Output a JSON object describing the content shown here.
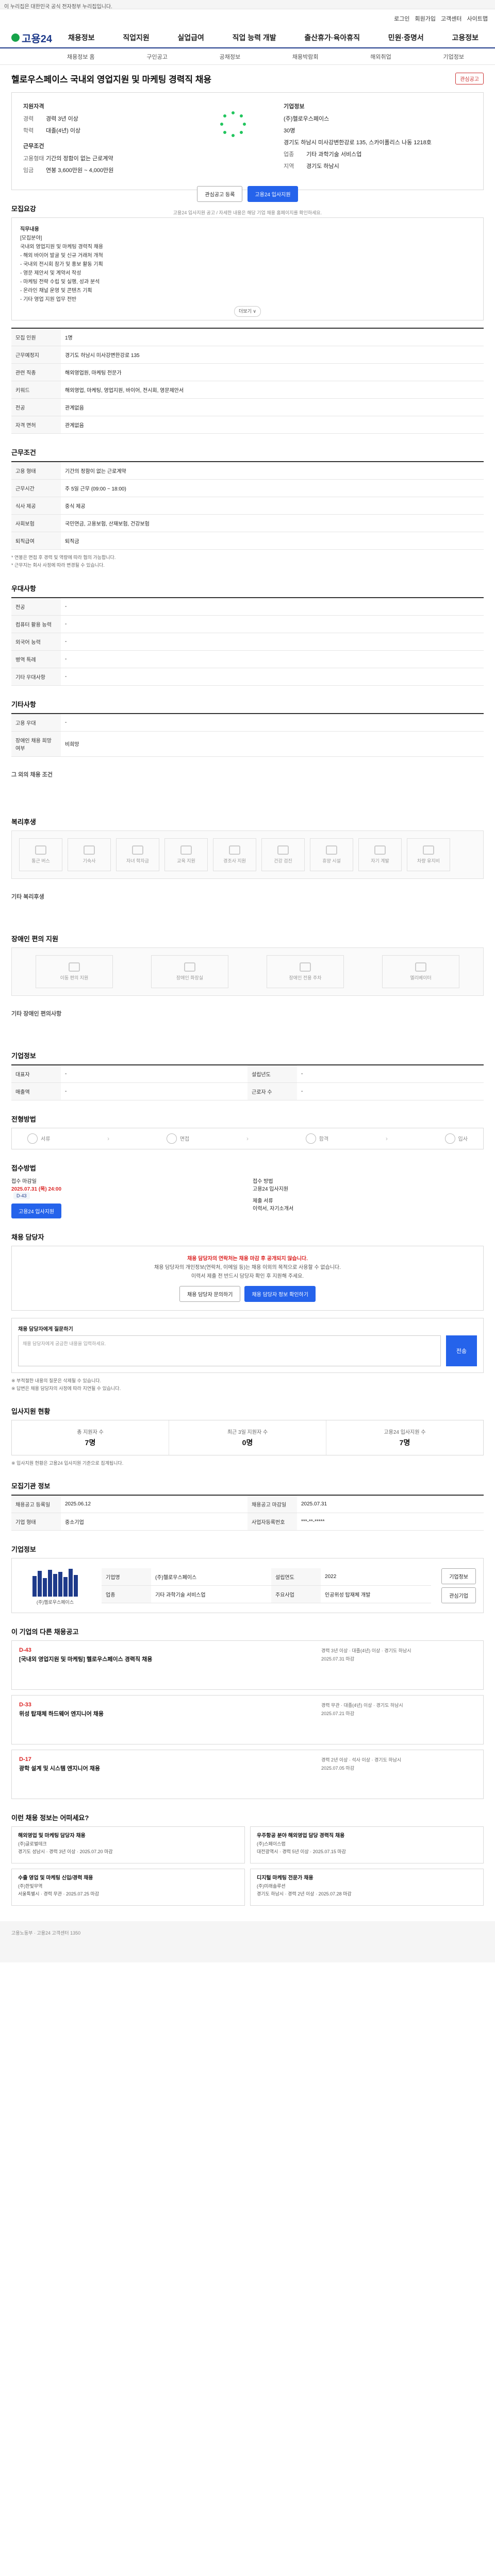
{
  "gov_bar": "이 누리집은 대한민국 공식 전자정부 누리집입니다.",
  "util": [
    "로그인",
    "회원가입",
    "고객센터",
    "사이트맵"
  ],
  "logo": "고용24",
  "gnb": [
    "채용정보",
    "직업지원",
    "실업급여",
    "직업 능력 개발",
    "출산휴가·육아휴직",
    "민원·증명서",
    "고용정보",
    "로그인"
  ],
  "lnb": [
    "채용정보 홈",
    "구인공고",
    "공채정보",
    "채용박람회",
    "해외취업",
    "기업정보"
  ],
  "job": {
    "title": "헬로우스페이스 국내외 영업지원 및 마케팅 경력직 채용",
    "scrap_label": "관심공고",
    "company_head": "기업정보",
    "company_name": "(주)헬로우스페이스",
    "employees": "30명",
    "address": "경기도 하남시 미사강변한강로 135, 스카이폴리스 나동 1218호",
    "type_label": "업종",
    "type_value": "기타 과학기술 서비스업",
    "cond_head": "지원자격",
    "career_k": "경력",
    "career_v": "경력 3년 이상",
    "edu_k": "학력",
    "edu_v": "대졸(4년) 이상",
    "work_head": "근무조건",
    "emp_k": "고용형태",
    "emp_v": "기간의 정함이 없는 근로계약",
    "wage_k": "임금",
    "wage_v": "연봉 3,600만원 ~ 4,000만원",
    "region_k": "지역",
    "region_v": "경기도 하남시",
    "scrap_btn": "관심공고 등록",
    "apply_btn": "고용24 입사지원",
    "note": "고용24 입사지원 공고 / 자세한 내용은 해당 기업 채용 홈페이지를 확인하세요."
  },
  "sections": {
    "recruit": "모집요강",
    "content_title": "직무내용",
    "content_sub": "[모집분야]",
    "content_lines": [
      "국내외 영업지원 및 마케팅 경력직 채용",
      "- 해외 바이어 발굴 및 신규 거래처 개척",
      "- 국내외 전시회 참가 및 홍보 활동 기획",
      "- 영문 제안서 및 계약서 작성",
      "- 마케팅 전략 수립 및 실행, 성과 분석",
      "- 온라인 채널 운영 및 콘텐츠 기획",
      "- 기타 영업 지원 업무 전반"
    ],
    "more": "더보기 ∨",
    "rows": [
      {
        "k": "모집 인원",
        "v": "1명"
      },
      {
        "k": "근무예정지",
        "v": "경기도 하남시 미사강변한강로 135"
      },
      {
        "k": "관련 직종",
        "v": "해외영업원, 마케팅 전문가"
      },
      {
        "k": "키워드",
        "v": "해외영업, 마케팅, 영업지원, 바이어, 전시회, 영문제안서"
      },
      {
        "k": "전공",
        "v": "관계없음"
      },
      {
        "k": "자격 면허",
        "v": "관계없음"
      }
    ],
    "work": "근무조건",
    "work_rows": [
      {
        "k": "고용 형태",
        "v": "기간의 정함이 없는 근로계약"
      },
      {
        "k": "근무시간",
        "v": "주 5일 근무 (09:00 ~ 18:00)"
      },
      {
        "k": "식사 제공",
        "v": "중식 제공"
      },
      {
        "k": "사회보험",
        "v": "국민연금, 고용보험, 산재보험, 건강보험"
      },
      {
        "k": "퇴직급여",
        "v": "퇴직금"
      }
    ],
    "work_notes": [
      "* 연봉은 면접 후 경력 및 역량에 따라 협의 가능합니다.",
      "* 근무지는 회사 사정에 따라 변경될 수 있습니다."
    ],
    "pref": "우대사항",
    "pref_rows": [
      {
        "k": "전공",
        "v": "-"
      },
      {
        "k": "컴퓨터 활용 능력",
        "v": "-"
      },
      {
        "k": "외국어 능력",
        "v": "-"
      },
      {
        "k": "병역 특례",
        "v": "-"
      },
      {
        "k": "기타 우대사항",
        "v": "-"
      }
    ],
    "etc": "기타사항",
    "etc_rows": [
      {
        "k": "고용 우대",
        "v": "-"
      },
      {
        "k": "장애인 채용 희망 여부",
        "v": "비희망"
      }
    ],
    "etc_extra": "그 외의 채용 조건",
    "welfare": "복리후생",
    "welfare_items": [
      "통근 버스",
      "기숙사",
      "자녀 학자금",
      "교육 지원",
      "경조사 지원",
      "건강 검진",
      "휴양 시설",
      "자기 계발",
      "차량 유지비"
    ],
    "welfare_extra": "기타 복리후생",
    "disab": "장애인 편의 지원",
    "disab_items": [
      "이동 편의 지원",
      "장애인 화장실",
      "장애인 전용 주차",
      "엘리베이터"
    ],
    "disab_extra": "기타 장애인 편의사항",
    "company_info": "기업정보",
    "ci_rows": [
      {
        "k": "대표자",
        "v": "-"
      },
      {
        "k": "설립년도",
        "v": "-"
      },
      {
        "k": "매출액",
        "v": "-"
      },
      {
        "k": "근로자 수",
        "v": "-"
      }
    ],
    "process": "전형방법",
    "process_steps": [
      "서류",
      "면접",
      "합격",
      "입사"
    ],
    "apply": "접수방법",
    "deadline_k": "접수 마감일",
    "deadline_v": "2025.07.31 (목) 24:00",
    "dday": "D-43",
    "method_k": "접수 방법",
    "method_v": "고용24 입사지원",
    "docs_k": "제출 서류",
    "docs_v": "이력서, 자기소개서",
    "contact": "채용 담당자",
    "contact_notice": "채용 담당자의 연락처는 채용 마감 후 공개되지 않습니다.",
    "contact_lines": [
      "채용 담당자의 개인정보(연락처, 이메일 등)는 채용 이외의 목적으로 사용할 수 없습니다.",
      "이력서 제출 전 반드시 담당자 확인 후 지원해 주세요."
    ],
    "contact_btn1": "채용 담당자 문의하기",
    "contact_btn2": "채용 담당자 정보 확인하기",
    "inq_title": "채용 담당자에게 질문하기",
    "inq_placeholder": "채용 담당자에게 궁금한 내용을 입력하세요.",
    "inq_btn": "전송",
    "inq_notes": [
      "※ 부적절한 내용의 질문은 삭제될 수 있습니다.",
      "※ 답변은 채용 담당자의 사정에 따라 지연될 수 있습니다."
    ],
    "stats": "입사지원 현황",
    "stats_items": [
      {
        "k": "총 지원자 수",
        "v": "7명"
      },
      {
        "k": "최근 3일 지원자 수",
        "v": "0명"
      },
      {
        "k": "고용24 입사지원 수",
        "v": "7명"
      }
    ],
    "stats_note": "※ 입사지원 현황은 고용24 입사지원 기준으로 집계됩니다.",
    "info": "모집기관 정보",
    "info_rows": [
      {
        "k": "채용공고 등록일",
        "v": "2025.06.12"
      },
      {
        "k": "채용공고 마감일",
        "v": "2025.07.31"
      },
      {
        "k": "기업 형태",
        "v": "중소기업"
      },
      {
        "k": "사업자등록번호",
        "v": "***-**-*****"
      }
    ],
    "corp": "기업정보",
    "corp_name": "(주)헬로우스페이스",
    "corp_rows": [
      {
        "k": "기업명",
        "v": "(주)헬로우스페이스"
      },
      {
        "k": "업종",
        "v": "기타 과학기술 서비스업"
      },
      {
        "k": "주요사업",
        "v": "인공위성 탑재체 개발"
      },
      {
        "k": "설립연도",
        "v": "2022"
      }
    ],
    "corp_btn1": "기업정보",
    "corp_btn2": "관심기업",
    "other_jobs": "이 기업의 다른 채용공고",
    "jobs": [
      {
        "dday": "D-43",
        "title": "[국내외 영업지원 및 마케팅] 헬로우스페이스 경력직 채용",
        "meta": "경력 3년 이상 · 대졸(4년) 이상 · 경기도 하남시",
        "date": "2025.07.31 마감"
      },
      {
        "dday": "D-33",
        "title": "위성 탑재체 하드웨어 엔지니어 채용",
        "meta": "경력 무관 · 대졸(4년) 이상 · 경기도 하남시",
        "date": "2025.07.21 마감"
      },
      {
        "dday": "D-17",
        "title": "광학 설계 및 시스템 엔지니어 채용",
        "meta": "경력 2년 이상 · 석사 이상 · 경기도 하남시",
        "date": "2025.07.05 마감"
      }
    ],
    "recommend": "이런 채용 정보는 어떠세요?",
    "recs": [
      {
        "t": "해외영업 및 마케팅 담당자 채용",
        "a": "(주)글로벌테크",
        "d": "경기도 성남시 · 경력 3년 이상 · 2025.07.20 마감"
      },
      {
        "t": "우주항공 분야 해외영업 담당 경력직 채용",
        "a": "(주)스페이스랩",
        "d": "대전광역시 · 경력 5년 이상 · 2025.07.15 마감"
      },
      {
        "t": "수출 영업 및 마케팅 신입/경력 채용",
        "a": "(주)한빛무역",
        "d": "서울특별시 · 경력 무관 · 2025.07.25 마감"
      },
      {
        "t": "디지털 마케팅 전문가 채용",
        "a": "(주)미래솔루션",
        "d": "경기도 하남시 · 경력 2년 이상 · 2025.07.28 마감"
      }
    ],
    "footer": "고용노동부 · 고용24 고객센터 1350"
  }
}
